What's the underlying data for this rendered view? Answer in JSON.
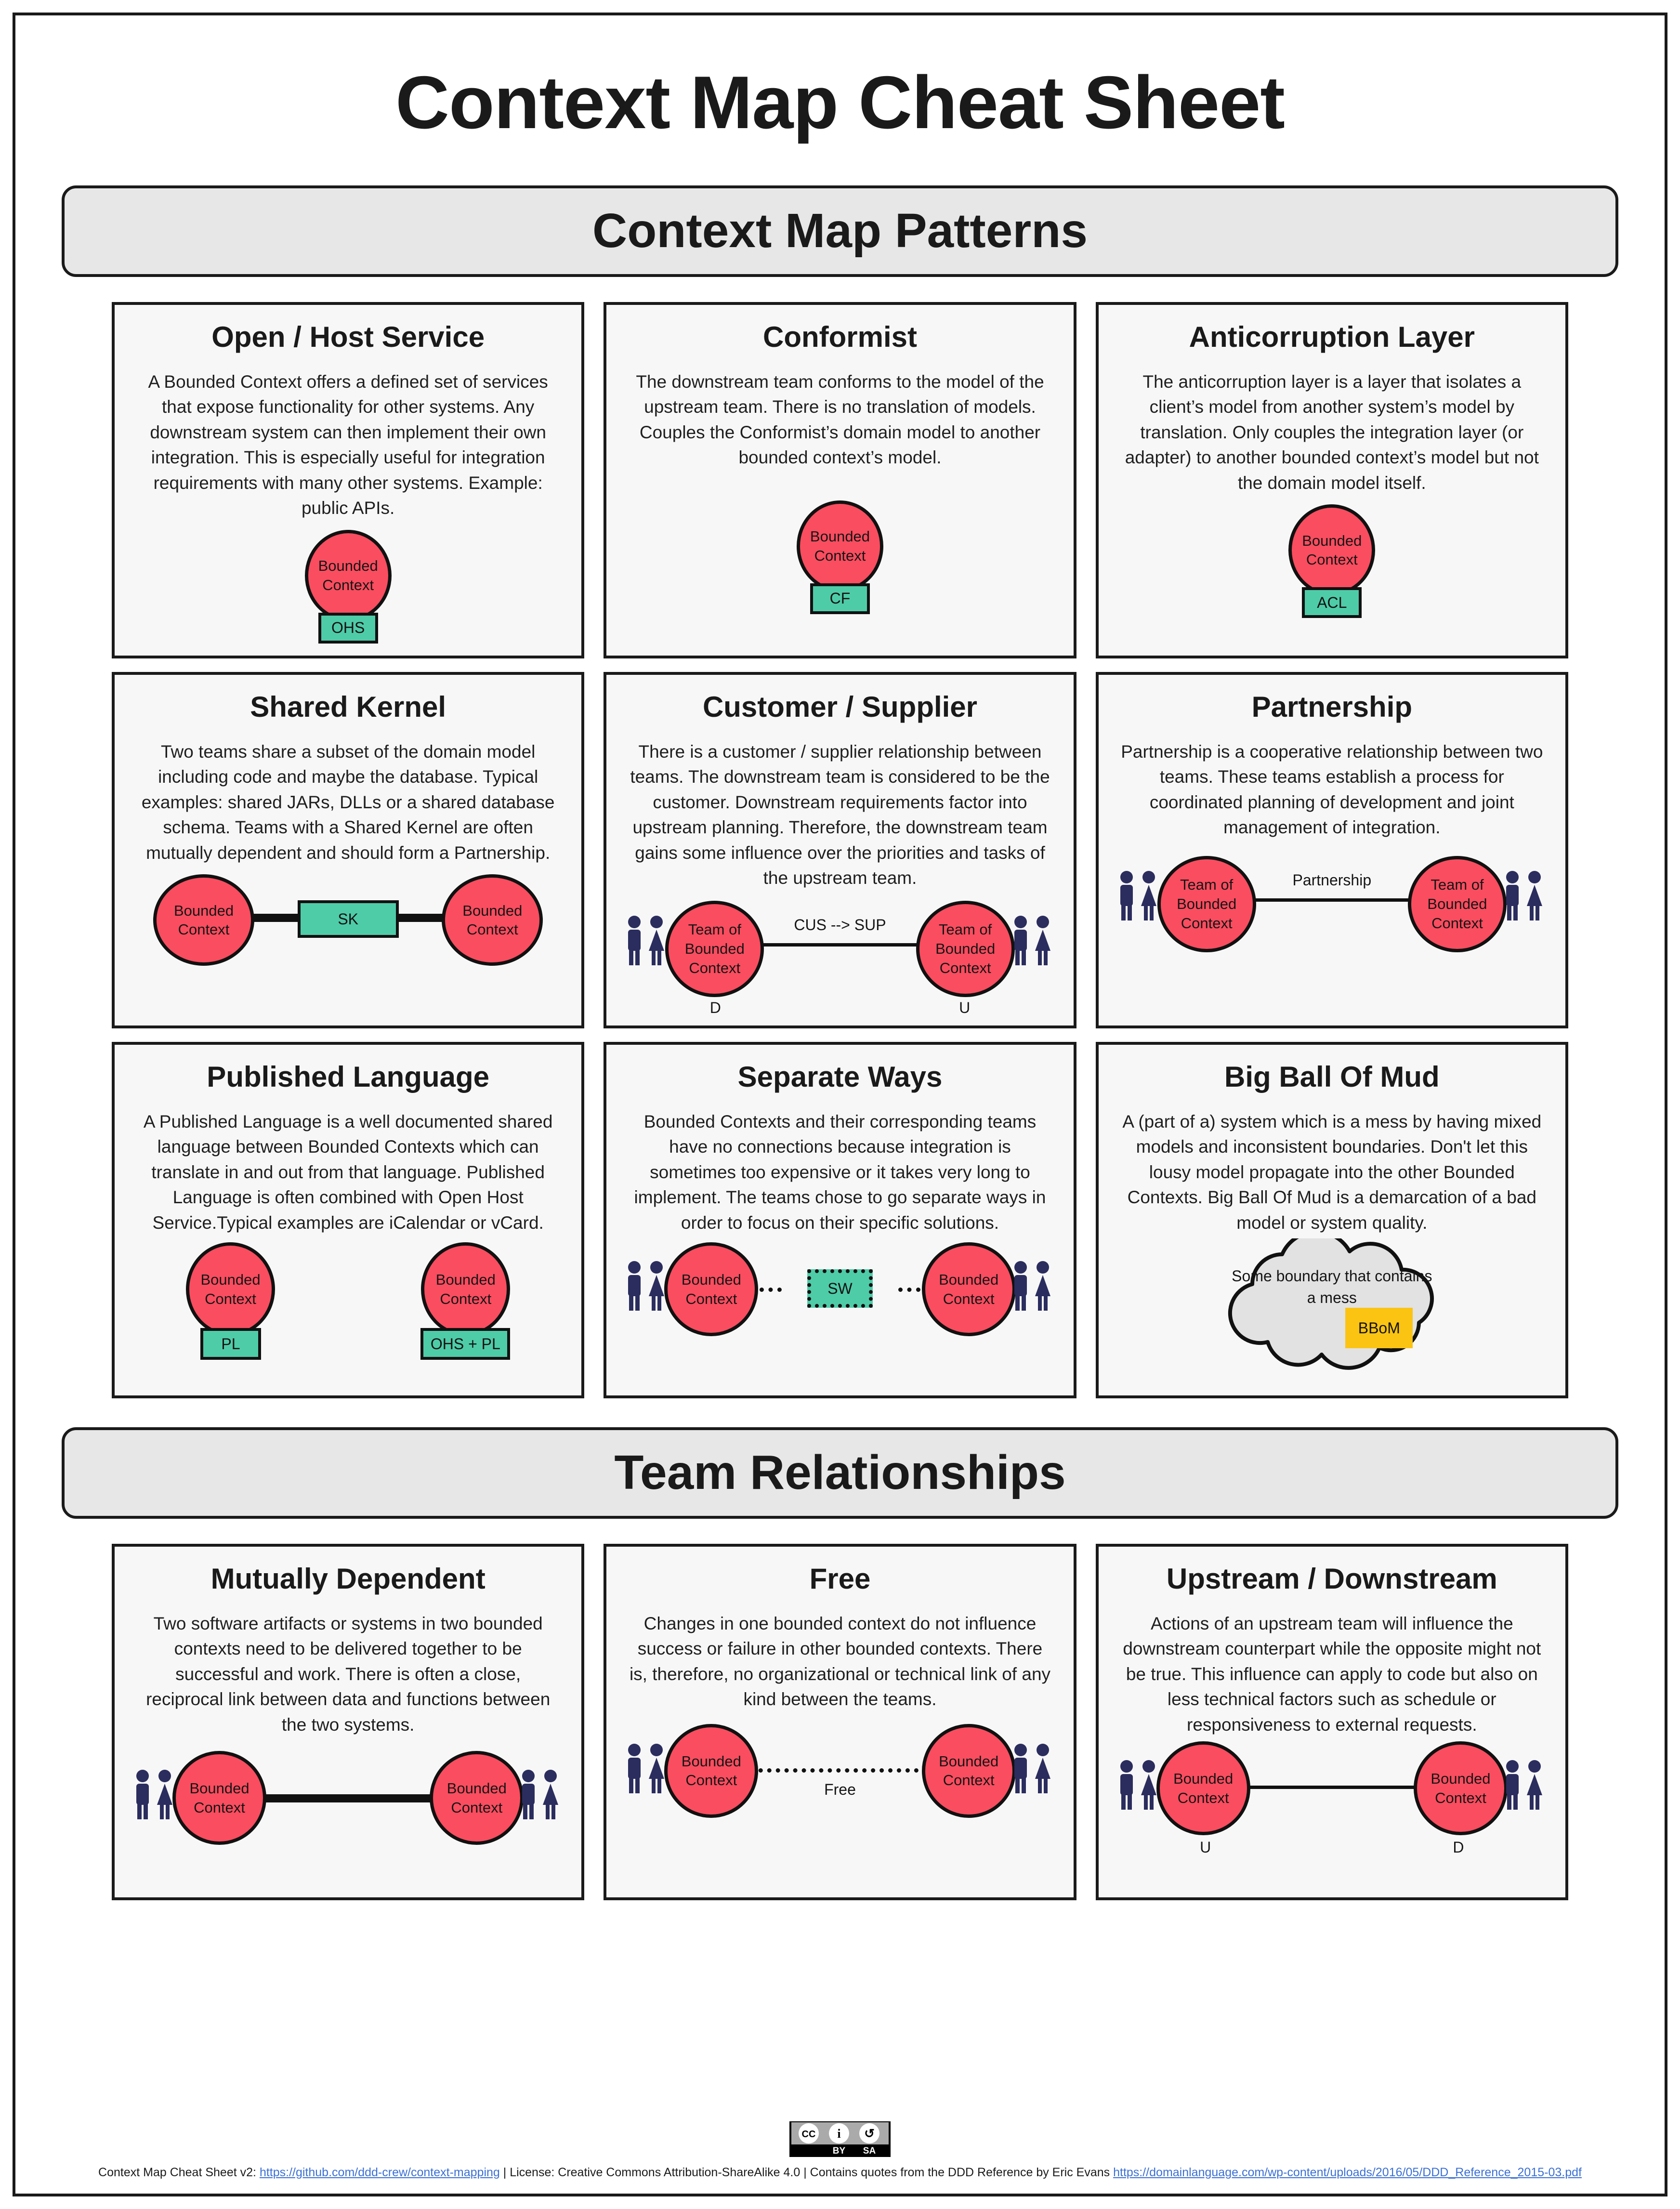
{
  "page": {
    "title": "Context Map Cheat Sheet"
  },
  "sections": [
    {
      "banner": "Context Map Patterns"
    },
    {
      "banner": "Team Relationships"
    }
  ],
  "patterns": [
    {
      "title": "Open / Host Service",
      "desc": "A Bounded Context offers a defined set of services that expose functionality for other systems. Any downstream system can then implement their own integration. This is especially useful for integration requirements with many other systems. Example: public APIs.",
      "node_label": "Bounded\nContext",
      "tag": "OHS"
    },
    {
      "title": "Conformist",
      "desc": "The downstream team conforms to the model of the upstream team. There is no translation of models. Couples the Conformist’s domain model to another bounded context’s model.",
      "node_label": "Bounded\nContext",
      "tag": "CF"
    },
    {
      "title": "Anticorruption Layer",
      "desc": "The anticorruption layer is a layer that isolates a client’s model from another system’s model by translation. Only couples the integration layer (or adapter) to another bounded context’s model but not the domain model itself.",
      "node_label": "Bounded\nContext",
      "tag": "ACL"
    },
    {
      "title": "Shared Kernel",
      "desc": "Two teams share a subset of the domain model including code and maybe the database. Typical examples: shared JARs, DLLs or a shared database schema. Teams with a Shared Kernel are often mutually dependent and should form a Partnership.",
      "left_node": "Bounded\nContext",
      "right_node": "Bounded\nContext",
      "tag": "SK"
    },
    {
      "title": "Customer / Supplier",
      "desc": "There is a customer / supplier relationship between teams. The downstream team is considered to be the customer. Downstream requirements factor into upstream planning. Therefore, the downstream team gains some influence over the priorities and tasks of the upstream team.",
      "left_node": "Team of\nBounded\nContext",
      "right_node": "Team of\nBounded\nContext",
      "link_label": "CUS  -->  SUP",
      "left_role": "D",
      "right_role": "U"
    },
    {
      "title": "Partnership",
      "desc": "Partnership is a cooperative relationship between two teams. These teams establish a process for coordinated planning of development and joint management of integration.",
      "left_node": "Team of\nBounded\nContext",
      "right_node": "Team of\nBounded\nContext",
      "link_label": "Partnership"
    },
    {
      "title": "Published Language",
      "desc": "A Published Language is a well documented shared language between Bounded Contexts which can translate in and out from that language. Published Language is often combined with Open Host Service.Typical examples are iCalendar or vCard.",
      "left_node": "Bounded\nContext",
      "right_node": "Bounded\nContext",
      "left_tag": "PL",
      "right_tag": "OHS + PL"
    },
    {
      "title": "Separate Ways",
      "desc": "Bounded Contexts and their corresponding teams have no connections because integration is sometimes too expensive or it takes very long to implement. The teams chose to go separate ways in order to focus on their specific solutions.",
      "left_node": "Bounded\nContext",
      "right_node": "Bounded\nContext",
      "tag": "SW"
    },
    {
      "title": "Big Ball Of Mud",
      "desc": "A (part of a) system which is a mess by having mixed models and inconsistent boundaries. Don't let this lousy model propagate into the other Bounded Contexts. Big Ball Of Mud is a demarcation of a bad model or system quality.",
      "cloud_label": "Some boundary that contains\na mess",
      "tag": "BBoM"
    }
  ],
  "team_relationships": [
    {
      "title": "Mutually Dependent",
      "desc": "Two software artifacts or systems in two bounded contexts need to be delivered together to be successful and work. There is often a close, reciprocal link between data and functions between the two systems.",
      "left_node": "Bounded\nContext",
      "right_node": "Bounded\nContext"
    },
    {
      "title": "Free",
      "desc": "Changes in one bounded context do not influence success or failure in other bounded contexts. There is, therefore, no organizational or technical link of any kind between the teams.",
      "left_node": "Bounded\nContext",
      "right_node": "Bounded\nContext",
      "link_label": "Free"
    },
    {
      "title": "Upstream / Downstream",
      "desc": "Actions of an upstream team will influence the downstream counterpart while the opposite might not be true.  This influence can apply to code but also on less technical factors such as schedule or responsiveness to external requests.",
      "left_node": "Bounded\nContext",
      "right_node": "Bounded\nContext",
      "left_role": "U",
      "right_role": "D"
    }
  ],
  "footer": {
    "license_badge": "cc-by-sa-badge",
    "badge_by": "BY",
    "badge_sa": "SA",
    "prefix": "Context Map Cheat Sheet v2: ",
    "repo_url": "https://github.com/ddd-crew/context-mapping",
    "middle": " | License: Creative Commons Attribution-ShareAlike 4.0 | Contains quotes from the DDD Reference by Eric Evans ",
    "ddd_url": "https://domainlanguage.com/wp-content/uploads/2016/05/DDD_Reference_2015-03.pdf"
  },
  "colors": {
    "bounded_context": "#fa4d5f",
    "tag": "#4ecca8",
    "bbom": "#fbc412",
    "people": "#2b2d5e",
    "banner_bg": "#e7e7e7",
    "card_bg": "#f7f7f7",
    "link": "#3b6fd4"
  }
}
